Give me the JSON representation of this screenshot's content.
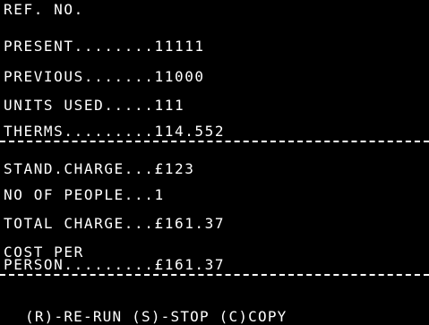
{
  "screen": {
    "ref_label": "REF. NO.",
    "present": "PRESENT........11111",
    "previous": "PREVIOUS.......11000",
    "units_used": "UNITS USED.....111",
    "therms": "THERMS.........114.552",
    "stand_charge": "STAND.CHARGE...£123",
    "no_of_people": "NO OF PEOPLE...1",
    "total_charge": "TOTAL CHARGE...£161.37",
    "cost_per_line1": "COST PER",
    "cost_per_line2": "PERSON.........£161.37",
    "footer": "(R)-RE-RUN (S)-STOP (C)COPY"
  },
  "colors": {
    "background": "#000000",
    "text": "#ffffff"
  }
}
